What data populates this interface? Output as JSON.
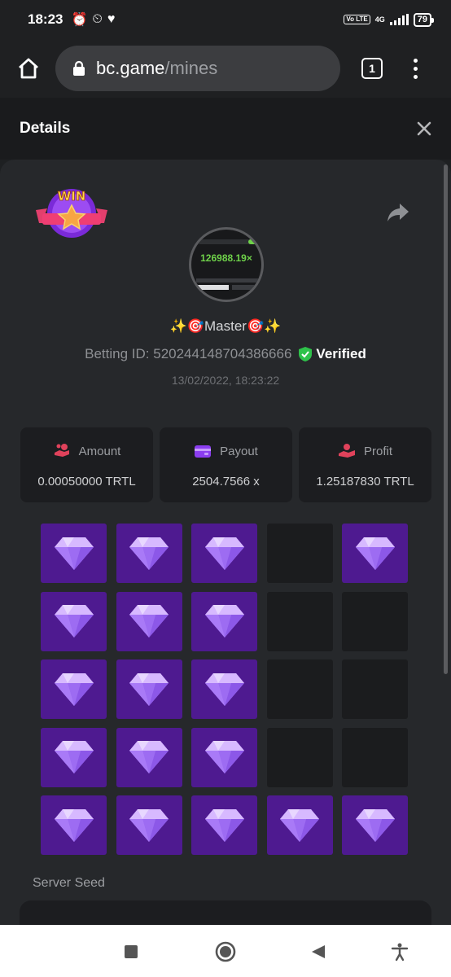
{
  "status_bar": {
    "time": "18:23",
    "network": "4G",
    "lte": "Vo LTE",
    "battery": "79"
  },
  "browser": {
    "url_host": "bc.game",
    "url_path": "/mines",
    "tab_count": "1"
  },
  "details": {
    "title": "Details",
    "user": {
      "emoji_left": "✨🎯",
      "name": "Master",
      "emoji_right": "🎯✨"
    },
    "avatar_value": "126988.19×",
    "betting_id_label": "Betting ID: 520244148704386666",
    "verified_label": "Verified",
    "timestamp": "13/02/2022, 18:23:22",
    "stats": [
      {
        "label": "Amount",
        "value": "0.00050000 TRTL",
        "icon": "hand-coins-icon",
        "color": "#e0425b"
      },
      {
        "label": "Payout",
        "value": "2504.7566 x",
        "icon": "card-icon",
        "color": "#8b3df0"
      },
      {
        "label": "Profit",
        "value": "1.25187830 TRTL",
        "icon": "hand-money-icon",
        "color": "#e0425b"
      }
    ],
    "board": [
      [
        "gem",
        "gem",
        "gem",
        "empty",
        "gem"
      ],
      [
        "gem",
        "gem",
        "gem",
        "empty",
        "empty"
      ],
      [
        "gem",
        "gem",
        "gem",
        "empty",
        "empty"
      ],
      [
        "gem",
        "gem",
        "gem",
        "empty",
        "empty"
      ],
      [
        "gem",
        "gem",
        "gem",
        "gem",
        "gem"
      ]
    ],
    "server_seed_label": "Server Seed",
    "win_badge_text": "WIN"
  },
  "colors": {
    "gem_tile": "#4e1a90",
    "empty_tile": "#1b1c1e",
    "verified": "#2ec24a",
    "avatar_value": "#6fd24a"
  }
}
